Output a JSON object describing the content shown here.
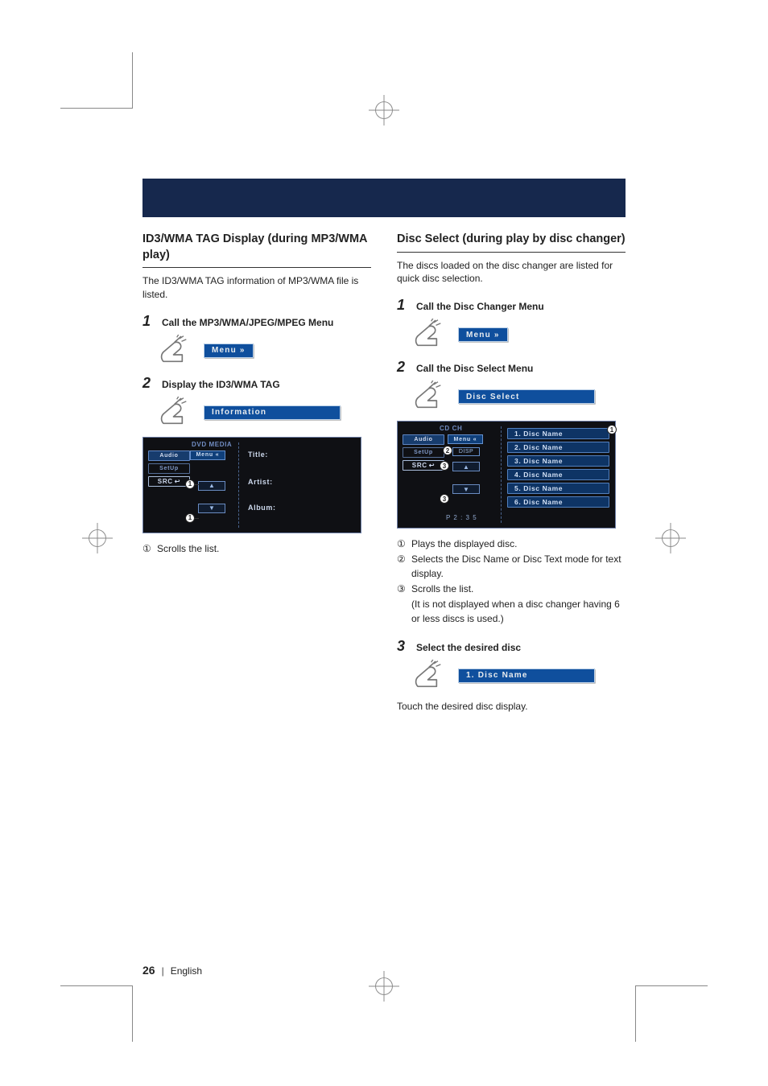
{
  "left": {
    "title": "ID3/WMA TAG Display (during MP3/WMA play)",
    "intro": "The ID3/WMA TAG information of MP3/WMA file is listed.",
    "step1": {
      "num": "1",
      "title": "Call the MP3/WMA/JPEG/MPEG Menu",
      "button": "Menu »"
    },
    "step2": {
      "num": "2",
      "title": "Display the ID3/WMA TAG",
      "button": "Information"
    },
    "screen": {
      "header": "DVD MEDIA",
      "side": {
        "audio": "Audio",
        "setup": "SetUp",
        "src": "SRC"
      },
      "menu": "Menu «",
      "title": "Title:",
      "artist": "Artist:",
      "album": "Album:"
    },
    "legend": {
      "n1": "①",
      "t1": "Scrolls the list."
    }
  },
  "right": {
    "title": "Disc Select (during play by disc changer)",
    "intro": "The discs loaded on the disc changer are listed for quick disc selection.",
    "step1": {
      "num": "1",
      "title": "Call the Disc Changer Menu",
      "button": "Menu »"
    },
    "step2": {
      "num": "2",
      "title": "Call the Disc Select Menu",
      "button": "Disc Select"
    },
    "screen": {
      "header": "CD CH",
      "side": {
        "audio": "Audio",
        "setup": "SetUp",
        "src": "SRC"
      },
      "menu": "Menu «",
      "disp": "DISP",
      "items": [
        "1. Disc Name",
        "2. Disc Name",
        "3. Disc Name",
        "4. Disc Name",
        "5. Disc Name",
        "6. Disc Name"
      ],
      "time": "P  2 : 3 5"
    },
    "legend": {
      "n1": "①",
      "t1": "Plays the displayed disc.",
      "n2": "②",
      "t2": "Selects the Disc Name or Disc Text mode for text display.",
      "n3": "③",
      "t3": "Scrolls the list.",
      "t3b": "(It is not displayed when a disc changer having 6 or less discs is used.)"
    },
    "step3": {
      "num": "3",
      "title": "Select the desired disc",
      "button": "1. Disc Name"
    },
    "note": "Touch the desired disc display."
  },
  "footer": {
    "page": "26",
    "lang": "English"
  },
  "icons": {
    "up": "▲",
    "down": "▼",
    "src_arrow": "↩"
  }
}
